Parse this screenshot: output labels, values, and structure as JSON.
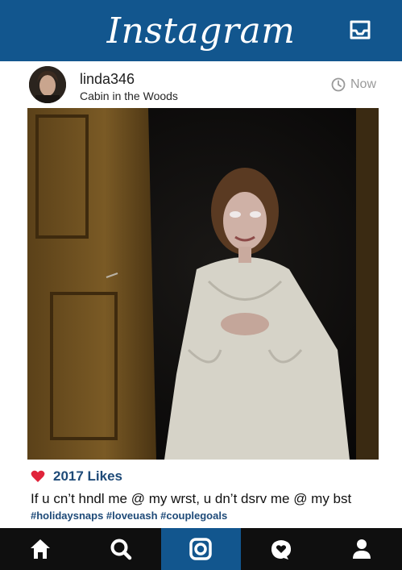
{
  "header": {
    "logo_text": "Instagram",
    "inbox_icon": "inbox-icon",
    "brand_color": "#12568e"
  },
  "post": {
    "username": "linda346",
    "location": "Cabin in the Woods",
    "time": "Now",
    "likes": "2017 Likes",
    "caption": "If u cn’t hndl me @ my wrst, u dn’t dsrv me @ my bst",
    "hashtags": "#holidaysnaps #loveuash #couplegoals"
  },
  "nav": {
    "items": [
      "home-icon",
      "search-icon",
      "camera-icon",
      "activity-icon",
      "profile-icon"
    ],
    "active_index": 2
  }
}
